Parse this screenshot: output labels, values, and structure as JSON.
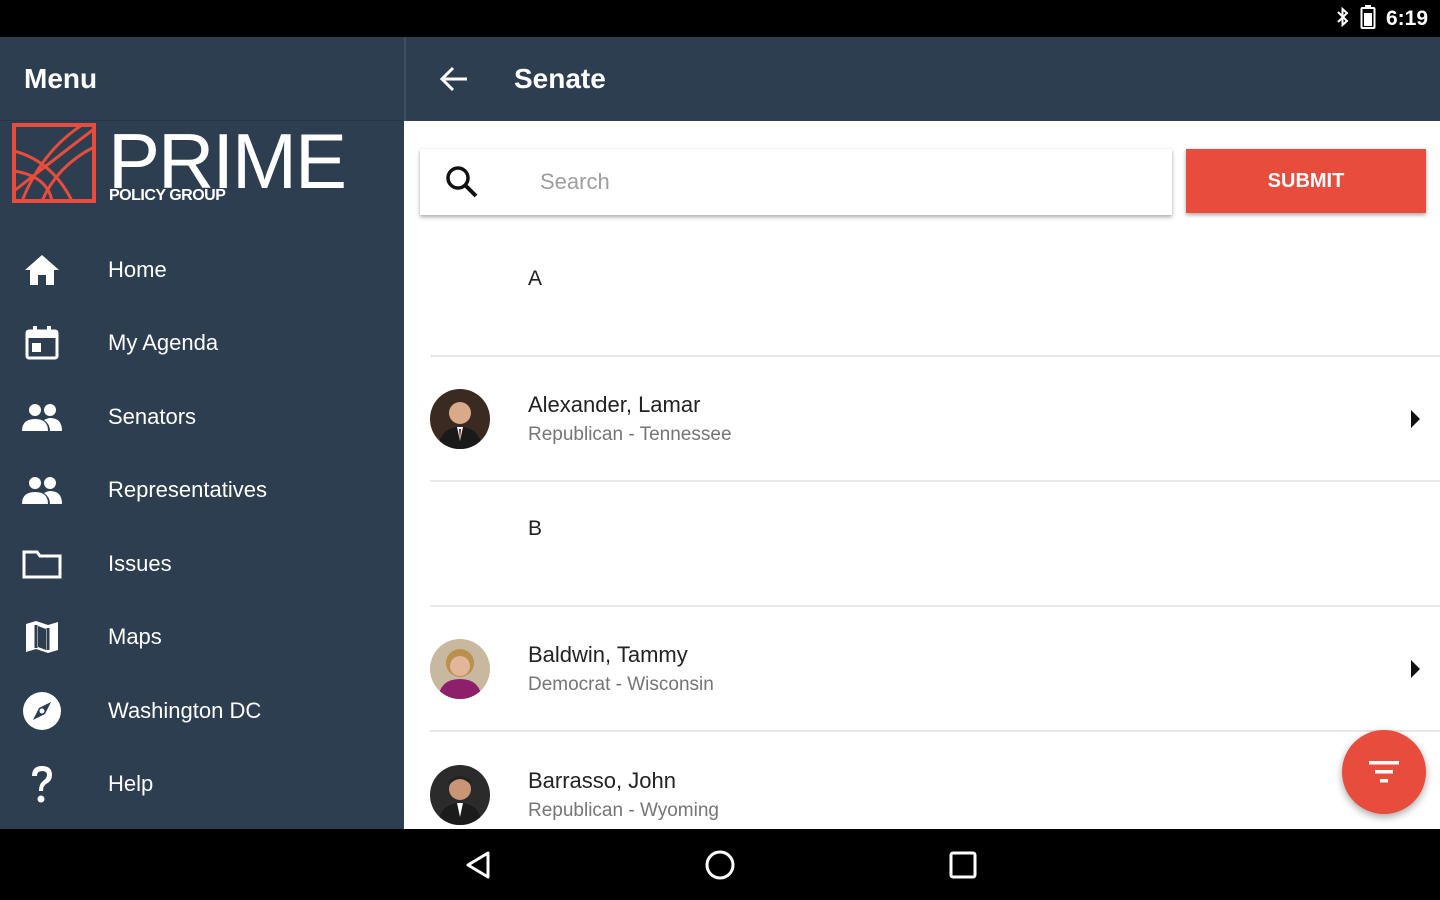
{
  "statusbar": {
    "time": "6:19",
    "icons": [
      "bluetooth-icon",
      "battery-icon"
    ]
  },
  "sidebar": {
    "title": "Menu",
    "brand": {
      "name": "PRIME",
      "sub": "POLICY GROUP"
    },
    "items": [
      {
        "label": "Home",
        "icon": "home-icon"
      },
      {
        "label": "My Agenda",
        "icon": "calendar-icon"
      },
      {
        "label": "Senators",
        "icon": "people-icon"
      },
      {
        "label": "Representatives",
        "icon": "people-icon"
      },
      {
        "label": "Issues",
        "icon": "folder-icon"
      },
      {
        "label": "Maps",
        "icon": "map-icon"
      },
      {
        "label": "Washington DC",
        "icon": "compass-icon"
      },
      {
        "label": "Help",
        "icon": "help-icon"
      }
    ]
  },
  "header": {
    "title": "Senate"
  },
  "search": {
    "placeholder": "Search",
    "value": "",
    "submit_label": "SUBMIT"
  },
  "list": {
    "sections": [
      {
        "letter": "A",
        "members": [
          {
            "name": "Alexander, Lamar",
            "detail": "Republican - Tennessee"
          }
        ]
      },
      {
        "letter": "B",
        "members": [
          {
            "name": "Baldwin, Tammy",
            "detail": "Democrat - Wisconsin"
          },
          {
            "name": "Barrasso, John",
            "detail": "Republican - Wyoming"
          }
        ]
      }
    ]
  },
  "colors": {
    "sidebar": "#2c3e50",
    "accent": "#e74c3c",
    "divider": "#e8e8e8"
  }
}
